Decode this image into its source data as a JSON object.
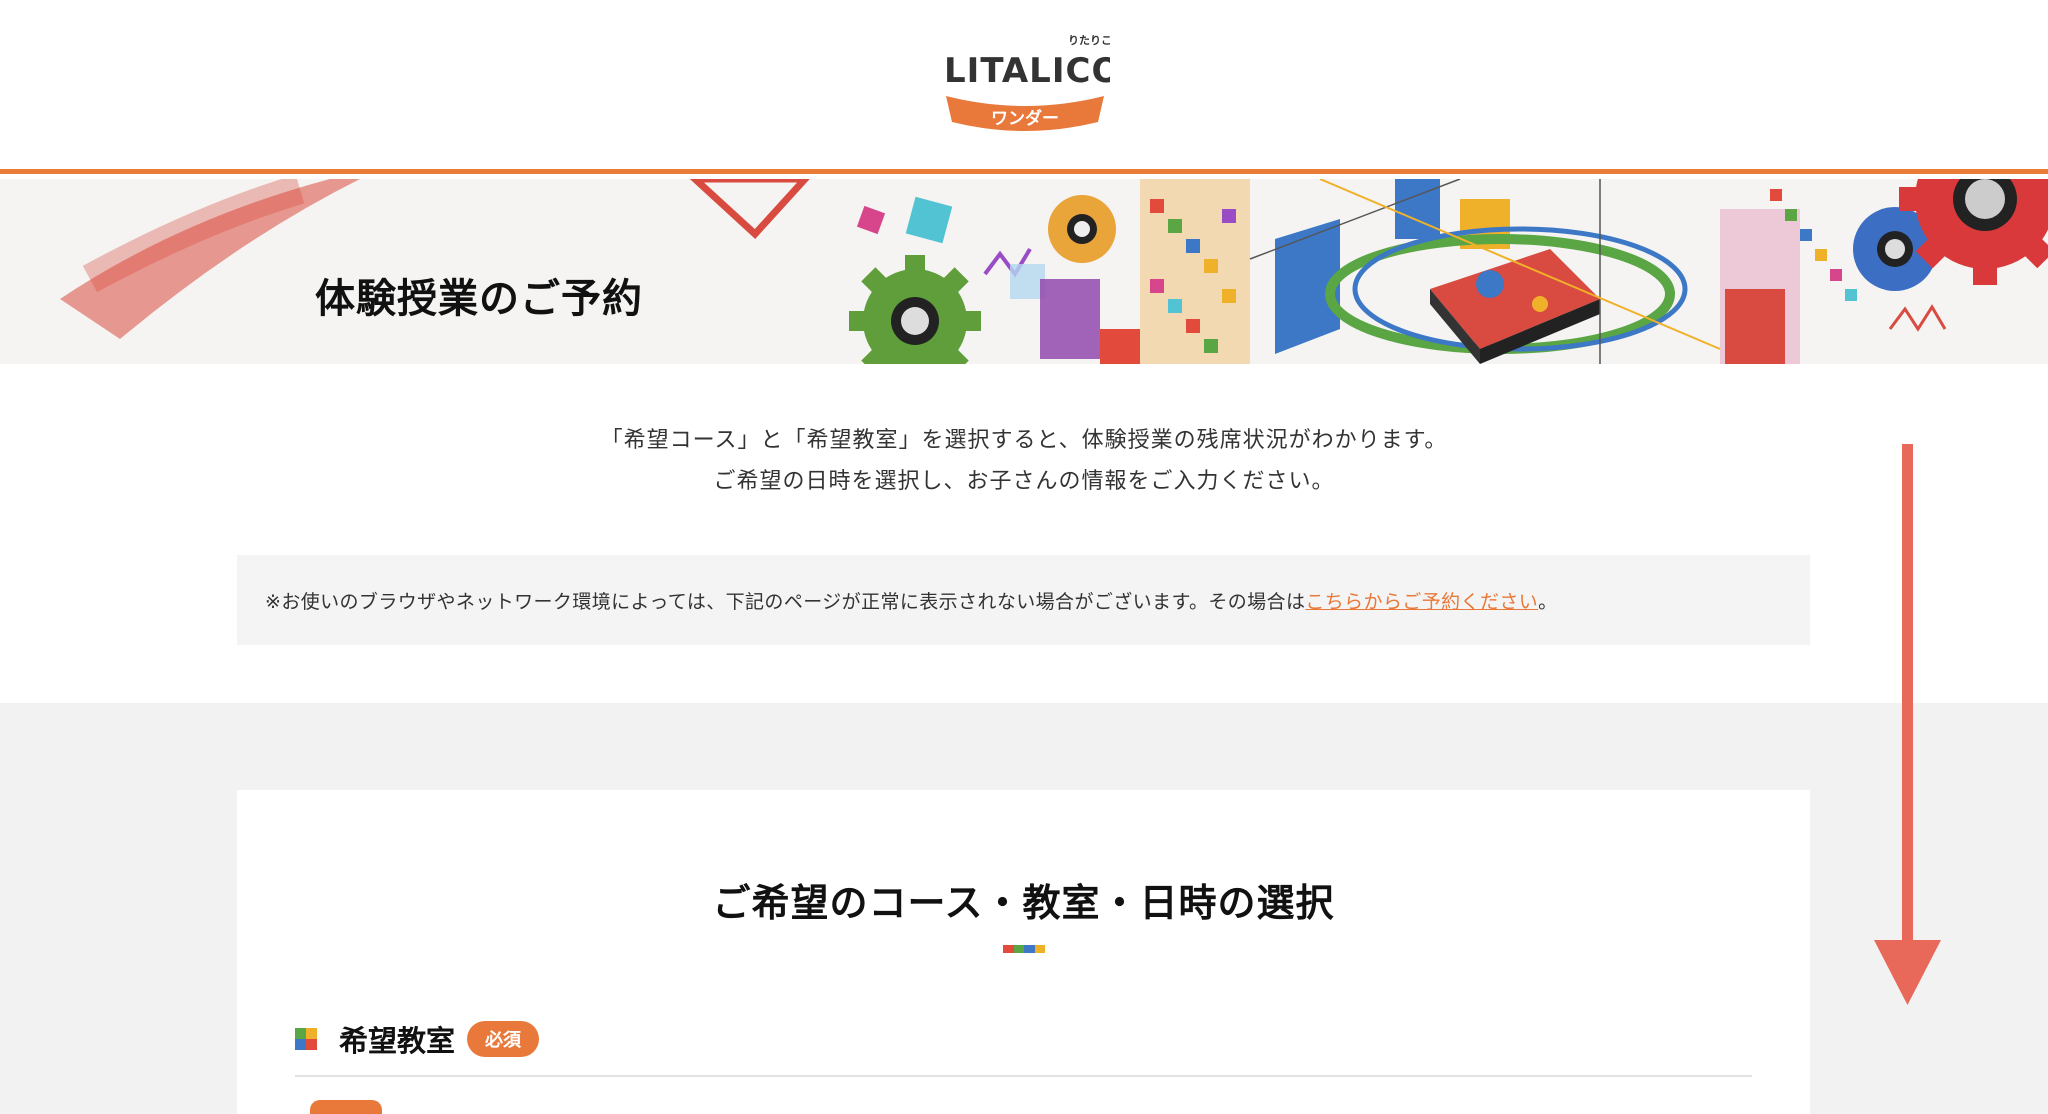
{
  "header": {
    "logo_small_text": "りたりこ",
    "logo_main_text": "LITALICO",
    "logo_sub_text": "ワンダー"
  },
  "hero": {
    "title": "体験授業のご予約"
  },
  "intro": {
    "line1": "「希望コース」と「希望教室」を選択すると、体験授業の残席状況がわかります。",
    "line2": "ご希望の日時を選択し、お子さんの情報をご入力ください。"
  },
  "notice": {
    "text": "※お使いのブラウザやネットワーク環境によっては、下記のページが正常に表示されない場合がございます。その場合は",
    "link_text": "こちらからご予約ください",
    "suffix": "。"
  },
  "form": {
    "section_title": "ご希望のコース・教室・日時の選択",
    "field_label": "希望教室",
    "required_badge": "必須"
  },
  "colors": {
    "accent": "#e8793a",
    "title_bar": [
      "#e24b3c",
      "#5aa544",
      "#3c78c6",
      "#f0b12a"
    ],
    "arrow": "#e8685a"
  }
}
